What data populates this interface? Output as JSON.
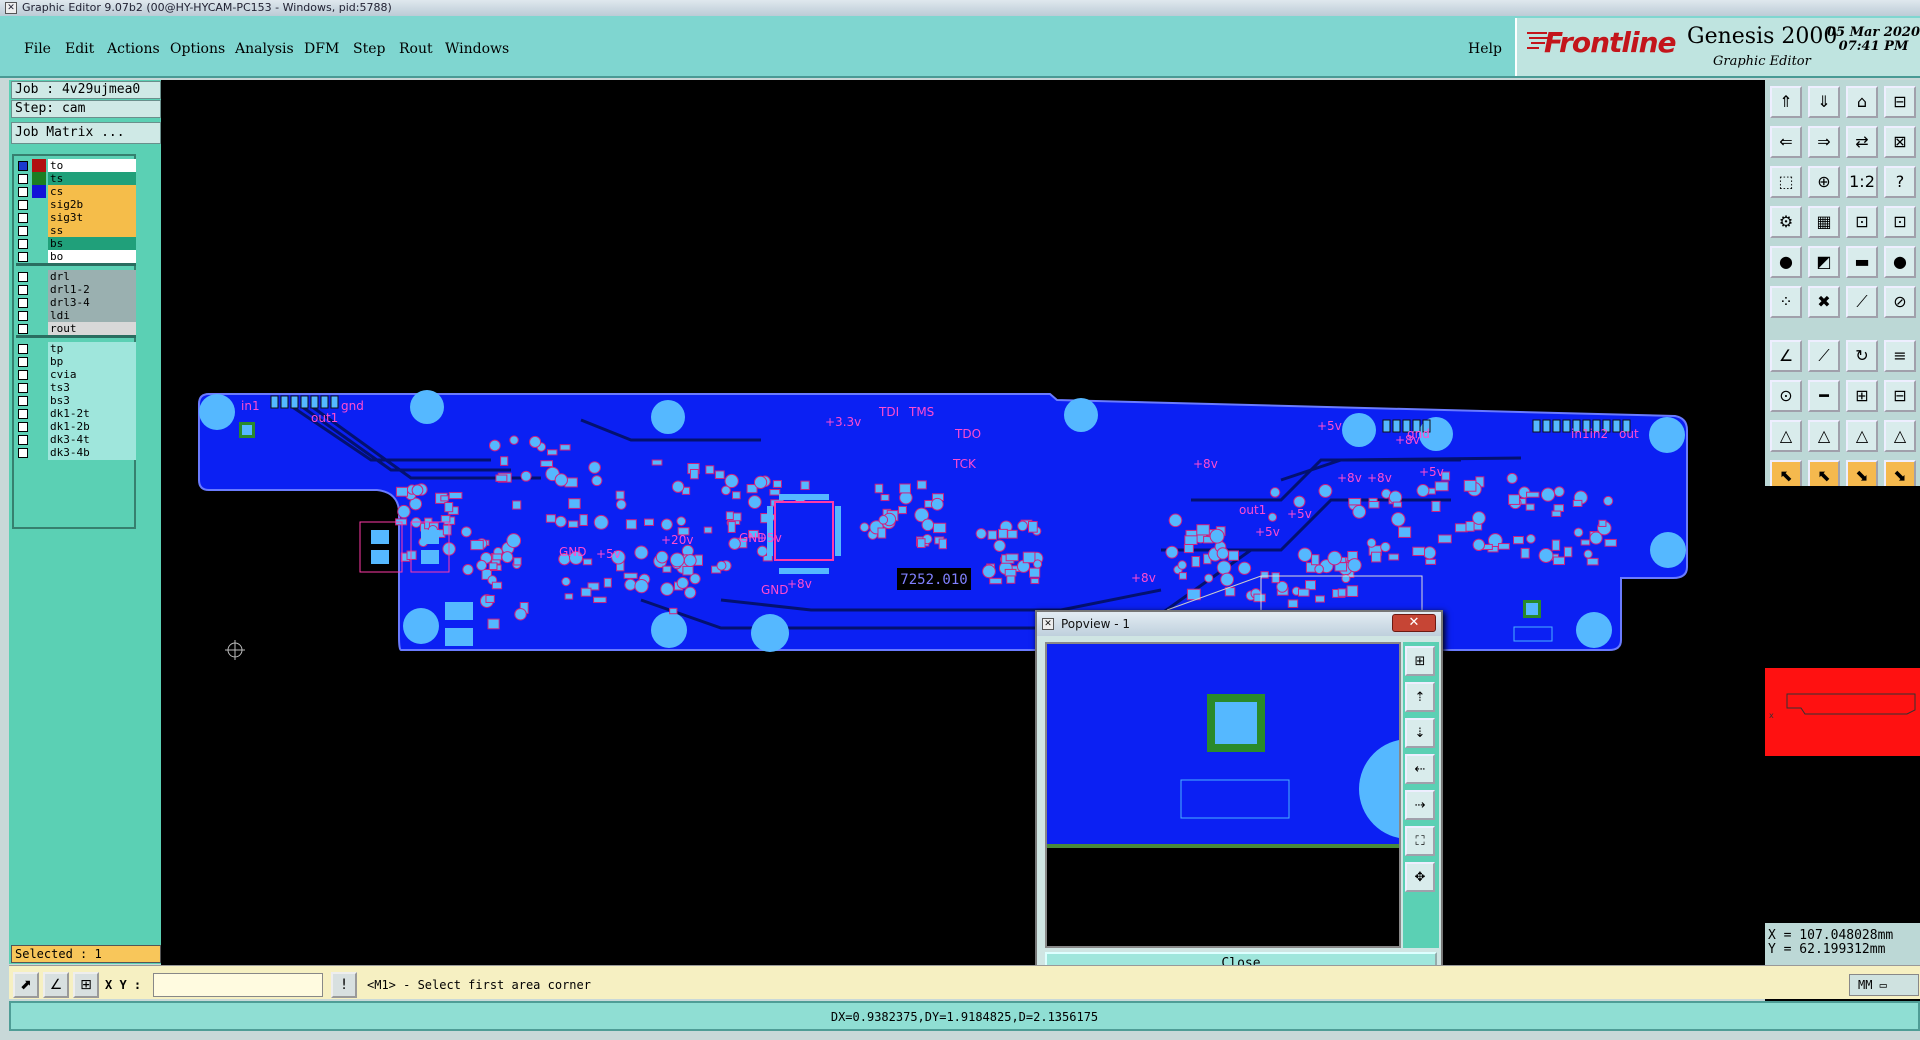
{
  "window_title": "Graphic Editor 9.07b2 (00@HY-HYCAM-PC153 - Windows, pid:5788)",
  "menu": [
    "File",
    "Edit",
    "Actions",
    "Options",
    "Analysis",
    "DFM",
    "Step",
    "Rout",
    "Windows"
  ],
  "help": "Help",
  "brand": {
    "logo": "Frontline",
    "product": "Genesis 2000",
    "subtitle": "Graphic Editor",
    "date": "05 Mar 2020",
    "time": "07:41 PM"
  },
  "left": {
    "job": "Job : 4v29ujmea0",
    "step": "Step: cam",
    "job_matrix": "Job Matrix ...",
    "selected": "Selected : 1"
  },
  "layers": [
    {
      "name": "to",
      "color": "#ffffff",
      "swatch": "#b01010"
    },
    {
      "name": "ts",
      "color": "#20a07a",
      "swatch": "#1c7d22"
    },
    {
      "name": "cs",
      "color": "#f5bd4a",
      "swatch": "#1212d8"
    },
    {
      "name": "sig2b",
      "color": "#f5bd4a",
      "swatch": "#5bd0b4"
    },
    {
      "name": "sig3t",
      "color": "#f5bd4a",
      "swatch": "#5bd0b4"
    },
    {
      "name": "ss",
      "color": "#f5bd4a",
      "swatch": "#5bd0b4"
    },
    {
      "name": "bs",
      "color": "#20a07a",
      "swatch": "#5bd0b4"
    },
    {
      "name": "bo",
      "color": "#ffffff",
      "swatch": "#5bd0b4"
    },
    {
      "name": "drl",
      "color": "#9ab0b0",
      "swatch": "#5bd0b4"
    },
    {
      "name": "drl1-2",
      "color": "#9ab0b0",
      "swatch": "#5bd0b4"
    },
    {
      "name": "drl3-4",
      "color": "#9ab0b0",
      "swatch": "#5bd0b4"
    },
    {
      "name": "ldi",
      "color": "#9ab0b0",
      "swatch": "#5bd0b4"
    },
    {
      "name": "rout",
      "color": "#d8d8d8",
      "swatch": "#5bd0b4"
    },
    {
      "name": "tp",
      "color": "#9fe6dc",
      "swatch": "#5bd0b4"
    },
    {
      "name": "bp",
      "color": "#9fe6dc",
      "swatch": "#5bd0b4"
    },
    {
      "name": "cvia",
      "color": "#9fe6dc",
      "swatch": "#5bd0b4"
    },
    {
      "name": "ts3",
      "color": "#9fe6dc",
      "swatch": "#5bd0b4"
    },
    {
      "name": "bs3",
      "color": "#9fe6dc",
      "swatch": "#5bd0b4"
    },
    {
      "name": "dk1-2t",
      "color": "#9fe6dc",
      "swatch": "#5bd0b4"
    },
    {
      "name": "dk1-2b",
      "color": "#9fe6dc",
      "swatch": "#5bd0b4"
    },
    {
      "name": "dk3-4t",
      "color": "#9fe6dc",
      "swatch": "#5bd0b4"
    },
    {
      "name": "dk3-4b",
      "color": "#9fe6dc",
      "swatch": "#5bd0b4"
    }
  ],
  "pcb_labels": [
    "in1",
    "gnd",
    "out1",
    "TDI",
    "TMS",
    "TDO",
    "TCK",
    "+3.3v",
    "GND",
    "+5v",
    "GND",
    "+5v",
    "+20v",
    "GND",
    "+8v",
    "+5v",
    "+8v",
    "+8v",
    "out1",
    "+5v",
    "+5v",
    "+8v",
    "+8v",
    "+5v",
    "+8v",
    "gnd",
    "in1in2",
    "out"
  ],
  "board_id": "7252.010",
  "popview": {
    "title": "Popview - 1",
    "close": "Close"
  },
  "coords": {
    "x": "X = 107.048028mm",
    "y": "Y = 62.199312mm"
  },
  "cmd": {
    "xy_label": "X Y :",
    "xy_value": "",
    "prompt": "<M1> - Select first area corner",
    "units": "MM"
  },
  "status": "DX=0.9382375,DY=1.9184825,D=2.1356175",
  "tool_icons": [
    "zoom-home",
    "zoom-in",
    "zoom-out",
    "zoom-fit",
    "pan",
    "1to1",
    "help",
    "grid",
    "snap",
    "measure"
  ]
}
